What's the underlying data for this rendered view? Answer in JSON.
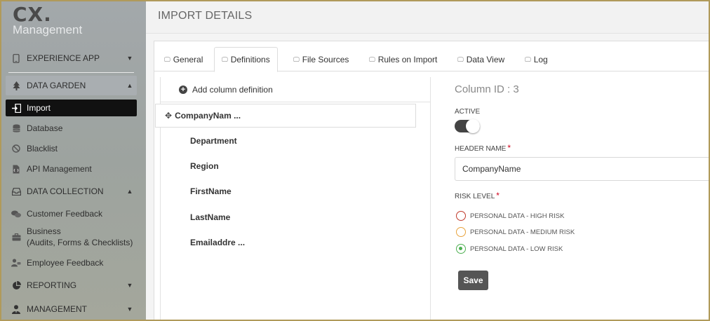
{
  "logo": {
    "brand": "CX.",
    "subtitle": "Management"
  },
  "sidebar": {
    "items": [
      {
        "label": "EXPERIENCE APP",
        "icon": "phone-icon"
      },
      {
        "label": "DATA GARDEN",
        "icon": "tree-icon"
      },
      {
        "label": "Import",
        "icon": "import-icon"
      },
      {
        "label": "Database",
        "icon": "database-icon"
      },
      {
        "label": "Blacklist",
        "icon": "ban-icon"
      },
      {
        "label": "API Management",
        "icon": "file-code-icon"
      },
      {
        "label": "DATA COLLECTION",
        "icon": "inbox-icon"
      },
      {
        "label": "Customer Feedback",
        "icon": "chat-icon"
      },
      {
        "label": "Business",
        "label2": "(Audits, Forms & Checklists)",
        "icon": "briefcase-icon"
      },
      {
        "label": "Employee Feedback",
        "icon": "user-comment-icon"
      },
      {
        "label": "REPORTING",
        "icon": "pie-chart-icon"
      },
      {
        "label": "MANAGEMENT",
        "icon": "user-tie-icon"
      }
    ]
  },
  "header": {
    "title": "IMPORT DETAILS"
  },
  "tabs": [
    {
      "label": "General"
    },
    {
      "label": "Definitions"
    },
    {
      "label": "File Sources"
    },
    {
      "label": "Rules on Import"
    },
    {
      "label": "Data View"
    },
    {
      "label": "Log"
    }
  ],
  "columns": {
    "add_label": "Add column definition",
    "selected": "CompanyNam ...",
    "items": [
      "Department",
      "Region",
      "FirstName",
      "LastName",
      "Emailaddre ..."
    ]
  },
  "detail": {
    "column_id": "Column ID : 3",
    "active_label": "ACTIVE",
    "active": true,
    "header_name_label": "HEADER NAME",
    "header_name_value": "CompanyName",
    "risk_level_label": "RISK LEVEL",
    "required_mark": "*",
    "risk_options": [
      {
        "label": "PERSONAL DATA - HIGH RISK",
        "color": "#c0392b",
        "selected": false
      },
      {
        "label": "PERSONAL DATA - MEDIUM RISK",
        "color": "#e8a33d",
        "selected": false
      },
      {
        "label": "PERSONAL DATA - LOW RISK",
        "color": "#4caf50",
        "selected": true
      }
    ],
    "save_label": "Save"
  }
}
